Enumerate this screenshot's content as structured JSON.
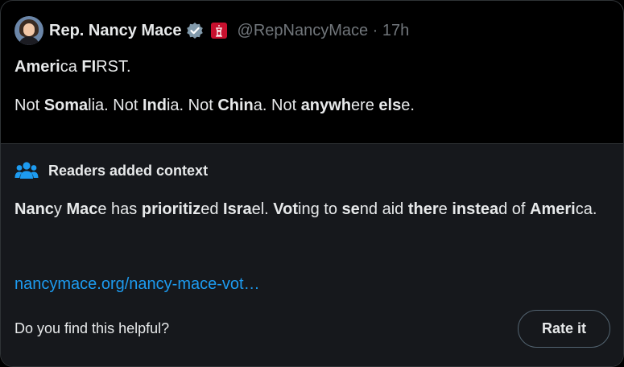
{
  "post": {
    "author_name": "Rep. Nancy Mace",
    "handle": "@RepNancyMace",
    "separator": "·",
    "time": "17h",
    "verified_icon": "verified-badge-icon",
    "affiliation_icon": "government-flag-icon",
    "text_line1": [
      {
        "t": "Ameri",
        "b": true
      },
      {
        "t": "ca ",
        "b": false
      },
      {
        "t": "FI",
        "b": true
      },
      {
        "t": "RST.",
        "b": false
      }
    ],
    "text_line2": [
      {
        "t": "Not ",
        "b": false
      },
      {
        "t": "Soma",
        "b": true
      },
      {
        "t": "lia. Not ",
        "b": false
      },
      {
        "t": "Ind",
        "b": true
      },
      {
        "t": "ia. Not ",
        "b": false
      },
      {
        "t": "Chin",
        "b": true
      },
      {
        "t": "a. Not ",
        "b": false
      },
      {
        "t": "anywh",
        "b": true
      },
      {
        "t": "ere ",
        "b": false
      },
      {
        "t": "els",
        "b": true
      },
      {
        "t": "e.",
        "b": false
      }
    ]
  },
  "context": {
    "icon": "readers-group-icon",
    "title": "Readers added context",
    "text": [
      {
        "t": "Nanc",
        "b": true
      },
      {
        "t": "y ",
        "b": false
      },
      {
        "t": "Mac",
        "b": true
      },
      {
        "t": "e has ",
        "b": false
      },
      {
        "t": "prioritiz",
        "b": true
      },
      {
        "t": "ed ",
        "b": false
      },
      {
        "t": "Isra",
        "b": true
      },
      {
        "t": "el. ",
        "b": false
      },
      {
        "t": "Vot",
        "b": true
      },
      {
        "t": "ing to ",
        "b": false
      },
      {
        "t": "se",
        "b": true
      },
      {
        "t": "nd aid ",
        "b": false
      },
      {
        "t": "ther",
        "b": true
      },
      {
        "t": "e ",
        "b": false
      },
      {
        "t": "instea",
        "b": true
      },
      {
        "t": "d of ",
        "b": false
      },
      {
        "t": "Ameri",
        "b": true
      },
      {
        "t": "ca.",
        "b": false
      }
    ],
    "link": "nancymace.org/nancy-mace-vot…",
    "helpful_question": "Do you find this helpful?",
    "rate_button": "Rate it"
  },
  "colors": {
    "background": "#000000",
    "context_background": "#16181c",
    "border": "#2f3336",
    "primary_text": "#e7e9ea",
    "secondary_text": "#71767b",
    "link": "#1d9bf0",
    "verified": "#829aab",
    "flag": "#c8102e"
  }
}
